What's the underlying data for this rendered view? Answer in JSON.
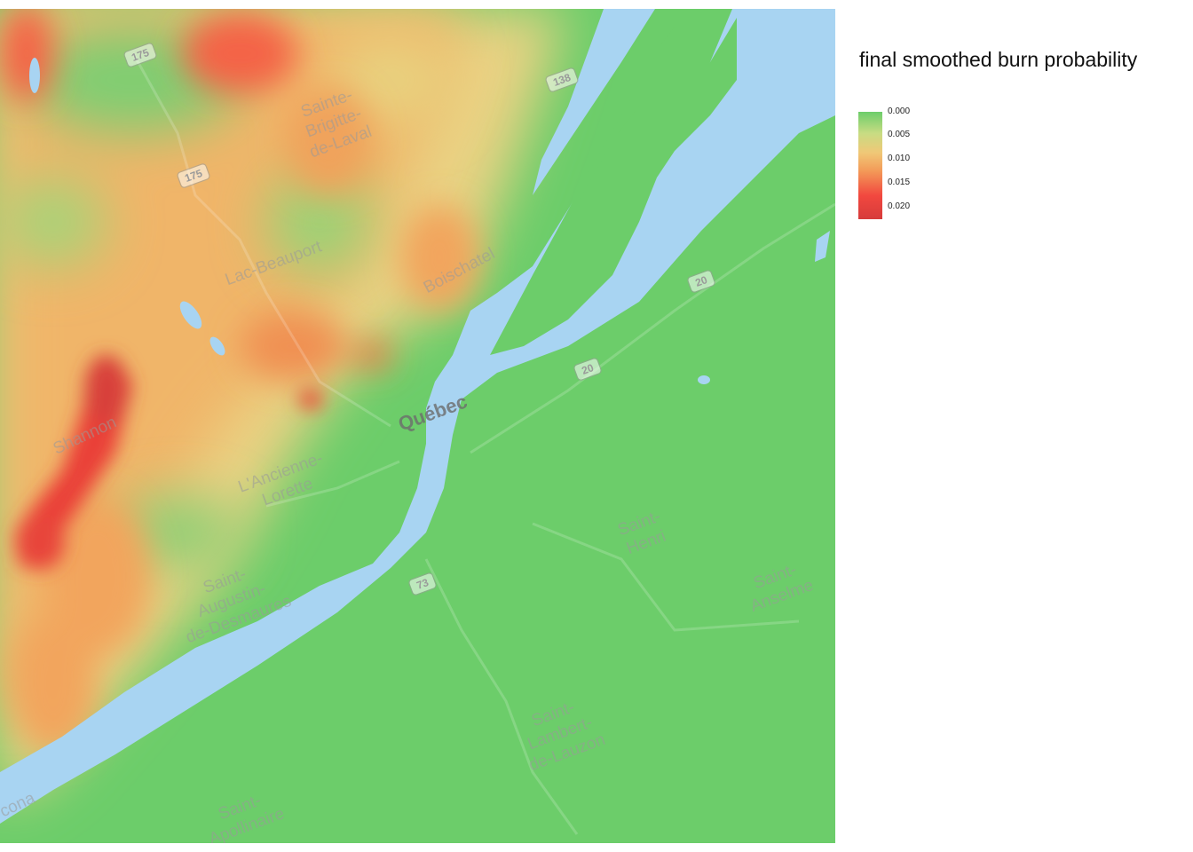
{
  "legend": {
    "title": "final smoothed burn probability",
    "ticks": [
      "0.000",
      "0.005",
      "0.010",
      "0.015",
      "0.020"
    ],
    "colors": [
      "#6ccd6a",
      "#c8dc83",
      "#f0c877",
      "#f39a58",
      "#f2483f",
      "#d63b3b"
    ]
  },
  "map": {
    "water_color": "#a8d4f2",
    "land_color": "#6ccd6a",
    "city": "Québec",
    "places": [
      {
        "id": "sainte-brigitte",
        "lines": [
          "Sainte-",
          "Brigitte-",
          "de-Laval"
        ]
      },
      {
        "id": "lac-beauport",
        "lines": [
          "Lac-Beauport"
        ]
      },
      {
        "id": "boischatel",
        "lines": [
          "Boischatel"
        ]
      },
      {
        "id": "shannon",
        "lines": [
          "Shannon"
        ]
      },
      {
        "id": "lancienne-lorette",
        "lines": [
          "L'Ancienne-",
          "Lorette"
        ]
      },
      {
        "id": "saint-augustin",
        "lines": [
          "Saint-",
          "Augustin-",
          "de-Desmaures"
        ]
      },
      {
        "id": "saint-henri",
        "lines": [
          "Saint-",
          "Henri"
        ]
      },
      {
        "id": "saint-anselme",
        "lines": [
          "Saint-",
          "Anselme"
        ]
      },
      {
        "id": "saint-lambert",
        "lines": [
          "Saint-",
          "Lambert-",
          "de-Lauzon"
        ]
      },
      {
        "id": "saint-apollinaire",
        "lines": [
          "Saint-",
          "Apollinaire"
        ]
      },
      {
        "id": "donnacona",
        "lines": [
          "cona"
        ]
      }
    ],
    "route_shields": [
      "175",
      "175",
      "138",
      "20",
      "20",
      "73"
    ]
  }
}
